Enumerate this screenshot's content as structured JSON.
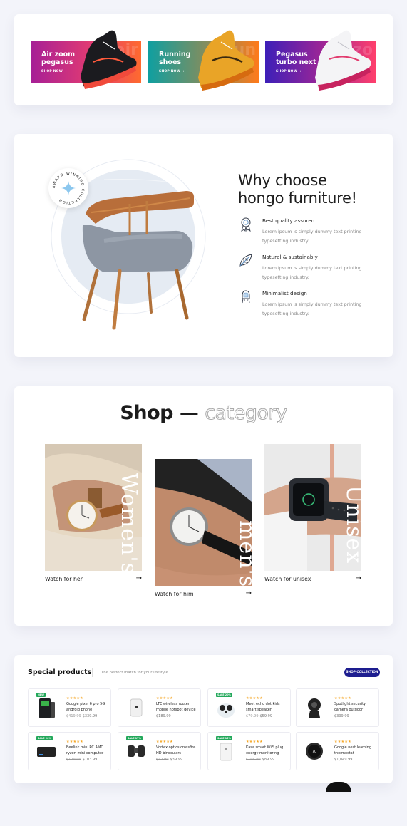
{
  "banners": [
    {
      "title": "Air zoom pegasus",
      "cta": "SHOP NOW →",
      "ghost": "air"
    },
    {
      "title": "Running shoes",
      "cta": "SHOP NOW →",
      "ghost": "run"
    },
    {
      "title": "Pegasus turbo next",
      "cta": "SHOP NOW →",
      "ghost": "zo"
    }
  ],
  "why": {
    "heading_line1": "Why choose",
    "heading_line2": "hongo furniture!",
    "badge_text": "AWARD WINNING COLLECTION",
    "features": [
      {
        "icon": "award-ribbon-icon",
        "title": "Best quality assured",
        "desc": "Lorem ipsum is simply dummy text printing typesetting industry."
      },
      {
        "icon": "leaf-icon",
        "title": "Natural & sustainably",
        "desc": "Lorem ipsum is simply dummy text printing typesetting industry."
      },
      {
        "icon": "chair-icon",
        "title": "Minimalist design",
        "desc": "Lorem ipsum is simply dummy text printing typesetting industry."
      }
    ]
  },
  "shop": {
    "heading_bold": "Shop —",
    "heading_outline": "category",
    "categories": [
      {
        "vertical": "Women's",
        "link": "Watch for her",
        "arrow": "→"
      },
      {
        "vertical": "men's",
        "link": "Watch for him",
        "arrow": "→"
      },
      {
        "vertical": "Unisex",
        "link": "Watch for unisex",
        "arrow": "→"
      }
    ]
  },
  "products": {
    "title": "Special products",
    "subtitle": "The perfect match for your lifestyle",
    "button": "SHOP COLLECTION",
    "items": [
      {
        "name": "Google pixel 6 pro 5G android phone",
        "old": "$419.99",
        "price": "$339.99",
        "sale": "NEW",
        "stars": "★★★★★"
      },
      {
        "name": "LTE wireless router, mobile hotspot device",
        "old": "",
        "price": "$189.99",
        "sale": "",
        "stars": "★★★★★"
      },
      {
        "name": "Meet echo dot kids smart speaker",
        "old": "$79.99",
        "price": "$59.99",
        "sale": "SALE 20%",
        "stars": "★★★★★"
      },
      {
        "name": "Spotlight security camera outdoor",
        "old": "",
        "price": "$399.99",
        "sale": "",
        "stars": "★★★★★"
      },
      {
        "name": "Beelink mini PC AMD ryzen mini computer",
        "old": "$129.99",
        "price": "$103.99",
        "sale": "SALE 20%",
        "stars": "★★★★★"
      },
      {
        "name": "Vortex optics crossfire HD binoculars",
        "old": "$47.99",
        "price": "$39.99",
        "sale": "SALE 17%",
        "stars": "★★★★★"
      },
      {
        "name": "Kasa smart WiFi plug energy monitoring",
        "old": "$104.99",
        "price": "$89.99",
        "sale": "SALE 15%",
        "stars": "★★★★★"
      },
      {
        "name": "Google nest learning thermostat",
        "old": "",
        "price": "$1,049.99",
        "sale": "",
        "stars": "★★★★★"
      }
    ]
  },
  "colors": {
    "banner1": [
      "#b5238f",
      "#ff6a2e"
    ],
    "banner2": [
      "#139f9f",
      "#ff7a1a"
    ],
    "banner3": [
      "#4a1fb8",
      "#ff3f6c"
    ],
    "accent_button": "#1d1d8f",
    "sale_badge": "#23a85b",
    "star": "#f5a623"
  }
}
